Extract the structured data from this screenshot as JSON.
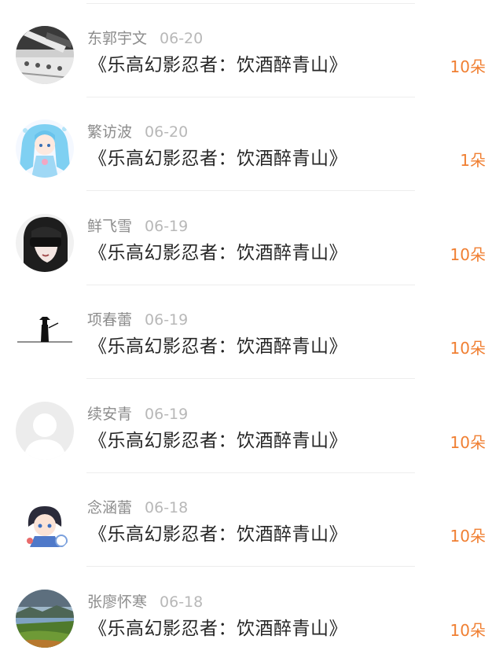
{
  "gift_list": {
    "items": [
      {
        "user": "东郭宇文",
        "date": "06-20",
        "title": "《乐高幻影忍者：饮酒醉青山》",
        "count": "10朵",
        "avatar_icon": "photo-avatar"
      },
      {
        "user": "繁访波",
        "date": "06-20",
        "title": "《乐高幻影忍者：饮酒醉青山》",
        "count": "1朵",
        "avatar_icon": "anime-girl-avatar"
      },
      {
        "user": "鲜飞雪",
        "date": "06-19",
        "title": "《乐高幻影忍者：饮酒醉青山》",
        "count": "10朵",
        "avatar_icon": "blindfold-avatar"
      },
      {
        "user": "项春蕾",
        "date": "06-19",
        "title": "《乐高幻影忍者：饮酒醉青山》",
        "count": "10朵",
        "avatar_icon": "swordsman-silhouette-avatar"
      },
      {
        "user": "续安青",
        "date": "06-19",
        "title": "《乐高幻影忍者：饮酒醉青山》",
        "count": "10朵",
        "avatar_icon": "default-user-avatar"
      },
      {
        "user": "念涵蕾",
        "date": "06-18",
        "title": "《乐高幻影忍者：饮酒醉青山》",
        "count": "10朵",
        "avatar_icon": "chibi-avatar"
      },
      {
        "user": "张廖怀寒",
        "date": "06-18",
        "title": "《乐高幻影忍者：饮酒醉青山》",
        "count": "10朵",
        "avatar_icon": "landscape-avatar"
      }
    ]
  }
}
